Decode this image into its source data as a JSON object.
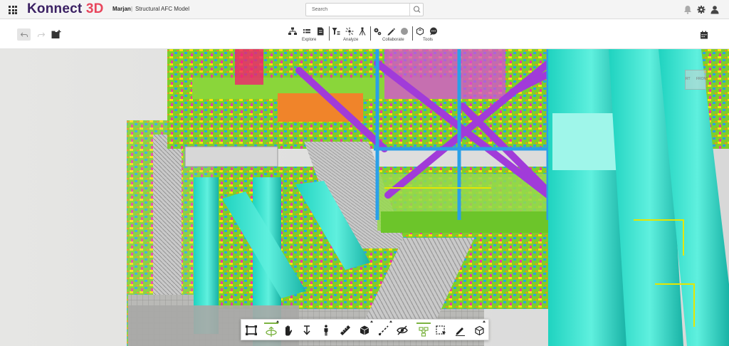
{
  "app": {
    "brand_main": "Konnect",
    "brand_accent": "3D",
    "user": "Marjan",
    "separator": "|",
    "model_name": "Structural AFC Model",
    "brand_color": "#3b2163",
    "accent_color": "#e8455c"
  },
  "search": {
    "placeholder": "Search",
    "value": ""
  },
  "header_icons": [
    "apps-grid-icon",
    "bell-icon",
    "gear-icon",
    "user-icon"
  ],
  "toolbar": {
    "left_buttons": [
      "undo-icon",
      "redo-icon",
      "add-to-folder-icon"
    ],
    "groups": [
      {
        "label": "Explore",
        "icons": [
          "hierarchy-icon",
          "list-icon",
          "document-icon"
        ]
      },
      {
        "label": "Analyze",
        "icons": [
          "filter-icon",
          "explode-icon",
          "measure-tripod-icon"
        ]
      },
      {
        "label": "Collaborate",
        "icons": [
          "settings-gears-icon",
          "markup-pen-icon",
          "record-icon"
        ]
      },
      {
        "label": "Tools",
        "icons": [
          "cube-refresh-icon",
          "comment-icon"
        ]
      }
    ],
    "right_icon": "calendar-icon"
  },
  "nav_cube": {
    "left_face": "RT",
    "front_face": "FRONT"
  },
  "navigation_bar": {
    "accent": "#7cb342",
    "tools": [
      {
        "icon": "fit-frame-icon",
        "active": false
      },
      {
        "icon": "orbit-icon",
        "active": true
      },
      {
        "icon": "pan-hand-icon",
        "active": false
      },
      {
        "icon": "zoom-arrow-icon",
        "active": false
      },
      {
        "icon": "walk-person-icon",
        "active": false
      },
      {
        "icon": "ruler-icon",
        "active": false
      },
      {
        "icon": "section-box-icon",
        "active": false
      },
      {
        "icon": "markup-line-icon",
        "active": false
      },
      {
        "icon": "hide-eye-icon",
        "active": false
      },
      {
        "icon": "model-tree-icon",
        "active": true
      },
      {
        "icon": "select-box-icon",
        "active": false
      },
      {
        "icon": "edit-pen-icon",
        "active": false
      },
      {
        "icon": "view-cube-icon",
        "active": false
      }
    ]
  }
}
